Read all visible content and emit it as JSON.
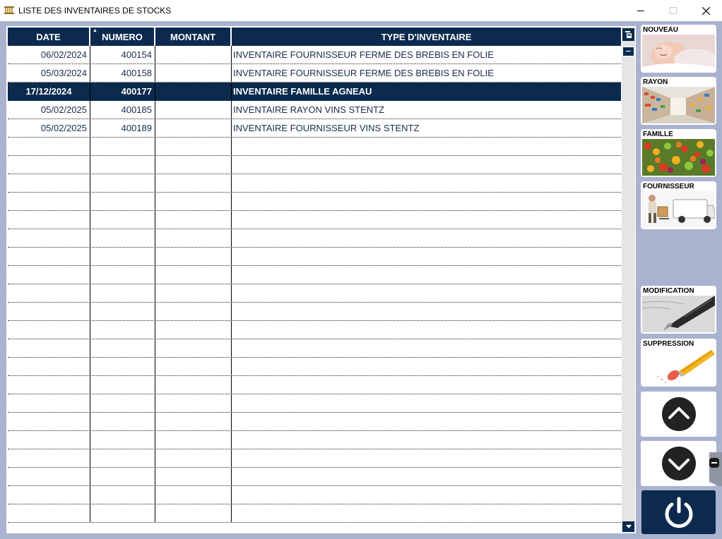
{
  "window": {
    "title": "LISTE DES INVENTAIRES DE STOCKS"
  },
  "table": {
    "columns": [
      "DATE",
      "NUMERO",
      "MONTANT",
      "TYPE D'INVENTAIRE"
    ],
    "rows": [
      {
        "date": "06/02/2024",
        "numero": "400154",
        "montant": "",
        "type": "INVENTAIRE FOURNISSEUR FERME DES BREBIS EN FOLIE",
        "selected": false
      },
      {
        "date": "05/03/2024",
        "numero": "400158",
        "montant": "",
        "type": "INVENTAIRE FOURNISSEUR FERME DES BREBIS EN FOLIE",
        "selected": false
      },
      {
        "date": "17/12/2024",
        "numero": "400177",
        "montant": "",
        "type": "INVENTAIRE FAMILLE AGNEAU",
        "selected": true
      },
      {
        "date": "05/02/2025",
        "numero": "400185",
        "montant": "",
        "type": "INVENTAIRE RAYON VINS STENTZ",
        "selected": false
      },
      {
        "date": "05/02/2025",
        "numero": "400189",
        "montant": "",
        "type": "INVENTAIRE FOURNISSEUR VINS STENTZ",
        "selected": false
      }
    ],
    "empty_rows": 21
  },
  "side_buttons": {
    "nouveau": "NOUVEAU",
    "rayon": "RAYON",
    "famille": "FAMILLE",
    "fournisseur": "FOURNISSEUR",
    "modification": "MODIFICATION",
    "suppression": "SUPPRESSION"
  },
  "colors": {
    "header_navy": "#0b2a4e",
    "background_lavender": "#a9b2cf",
    "row_text": "#1a2c4a"
  },
  "icons": {
    "up": "chevron-up-circle-icon",
    "down": "chevron-down-circle-icon",
    "power": "power-icon"
  }
}
